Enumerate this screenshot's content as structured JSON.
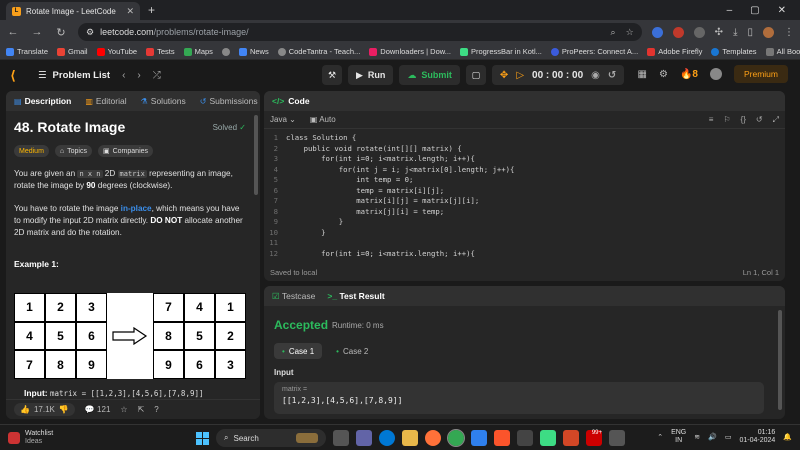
{
  "browser": {
    "tab_title": "Rotate Image - LeetCode",
    "url_host": "leetcode.com",
    "url_path": "/problems/rotate-image/",
    "bookmarks": [
      "Translate",
      "Gmail",
      "YouTube",
      "Tests",
      "Maps",
      "News",
      "CodeTantra - Teach...",
      "Downloaders | Dow...",
      "ProgressBar in Kotl...",
      "ProPeers: Connect A...",
      "Adobe Firefly",
      "Templates"
    ],
    "all_bookmarks": "All Bookmarks"
  },
  "lc_nav": {
    "problem_list": "Problem List",
    "run": "Run",
    "submit": "Submit",
    "timer": "00 : 00 : 00",
    "streak": "8",
    "premium": "Premium"
  },
  "left": {
    "tabs": [
      "Description",
      "Editorial",
      "Solutions",
      "Submissions"
    ],
    "title": "48. Rotate Image",
    "solved": "Solved",
    "tags": [
      "Medium",
      "Topics",
      "Companies"
    ],
    "p1_a": "You are given an ",
    "p1_code1": "n x n",
    "p1_b": " 2D ",
    "p1_code2": "matrix",
    "p1_c": " representing an image, rotate the image by ",
    "p1_bold": "90",
    "p1_d": " degrees (clockwise).",
    "p2_a": "You have to rotate the image ",
    "p2_link": "in-place",
    "p2_b": ", which means you have to modify the input 2D matrix directly. ",
    "p2_bold": "DO NOT",
    "p2_c": " allocate another 2D matrix and do the rotation.",
    "example_title": "Example 1:",
    "grid_before": [
      "1",
      "2",
      "3",
      "4",
      "5",
      "6",
      "7",
      "8",
      "9"
    ],
    "grid_after": [
      "7",
      "4",
      "1",
      "8",
      "5",
      "2",
      "9",
      "6",
      "3"
    ],
    "input_label": "Input:",
    "input_value": "matrix = [[1,2,3],[4,5,6],[7,8,9]]",
    "likes": "17.1K",
    "comments": "121"
  },
  "code": {
    "header": "Code",
    "language": "Java",
    "mode": "Auto",
    "lines": [
      "class Solution {",
      "    public void rotate(int[][] matrix) {",
      "        for(int i=0; i<matrix.length; i++){",
      "            for(int j = i; j<matrix[0].length; j++){",
      "                int temp = 0;",
      "                temp = matrix[i][j];",
      "                matrix[i][j] = matrix[j][i];",
      "                matrix[j][i] = temp;",
      "            }",
      "        }",
      "",
      "        for(int i=0; i<matrix.length; i++){"
    ],
    "saved": "Saved to local",
    "cursor": "Ln 1, Col 1"
  },
  "test": {
    "tab_testcase": "Testcase",
    "tab_result": "Test Result",
    "status": "Accepted",
    "runtime": "Runtime: 0 ms",
    "cases": [
      "Case 1",
      "Case 2"
    ],
    "input_label": "Input",
    "var_name": "matrix =",
    "var_value": "[[1,2,3],[4,5,6],[7,8,9]]"
  },
  "taskbar": {
    "weather_title": "Watchlist",
    "weather_sub": "Ideas",
    "search": "Search",
    "lang1": "ENG",
    "lang2": "IN",
    "time": "01:16",
    "date": "01-04-2024",
    "badge": "99+"
  }
}
